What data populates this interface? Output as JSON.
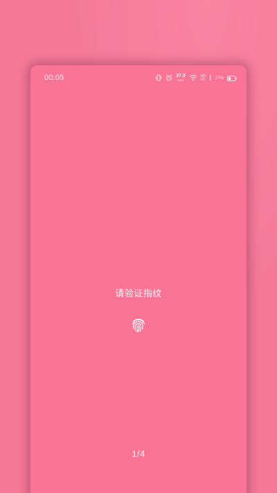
{
  "status_bar": {
    "time": "00:05",
    "speed_value": "37.0",
    "speed_unit": "KB/S",
    "network_top": "HD",
    "network_bottom": "4G",
    "battery_percent": "27%",
    "icons": [
      "vibrate-icon",
      "alarm-icon",
      "wifi-icon",
      "signal-icon",
      "battery-icon"
    ]
  },
  "lock": {
    "prompt": "请验证指纹",
    "fingerprint_icon": "fingerprint-icon",
    "pager": "1/4"
  },
  "colors": {
    "background": "#f6799a",
    "screen": "#f87395",
    "text": "#ffffff"
  }
}
